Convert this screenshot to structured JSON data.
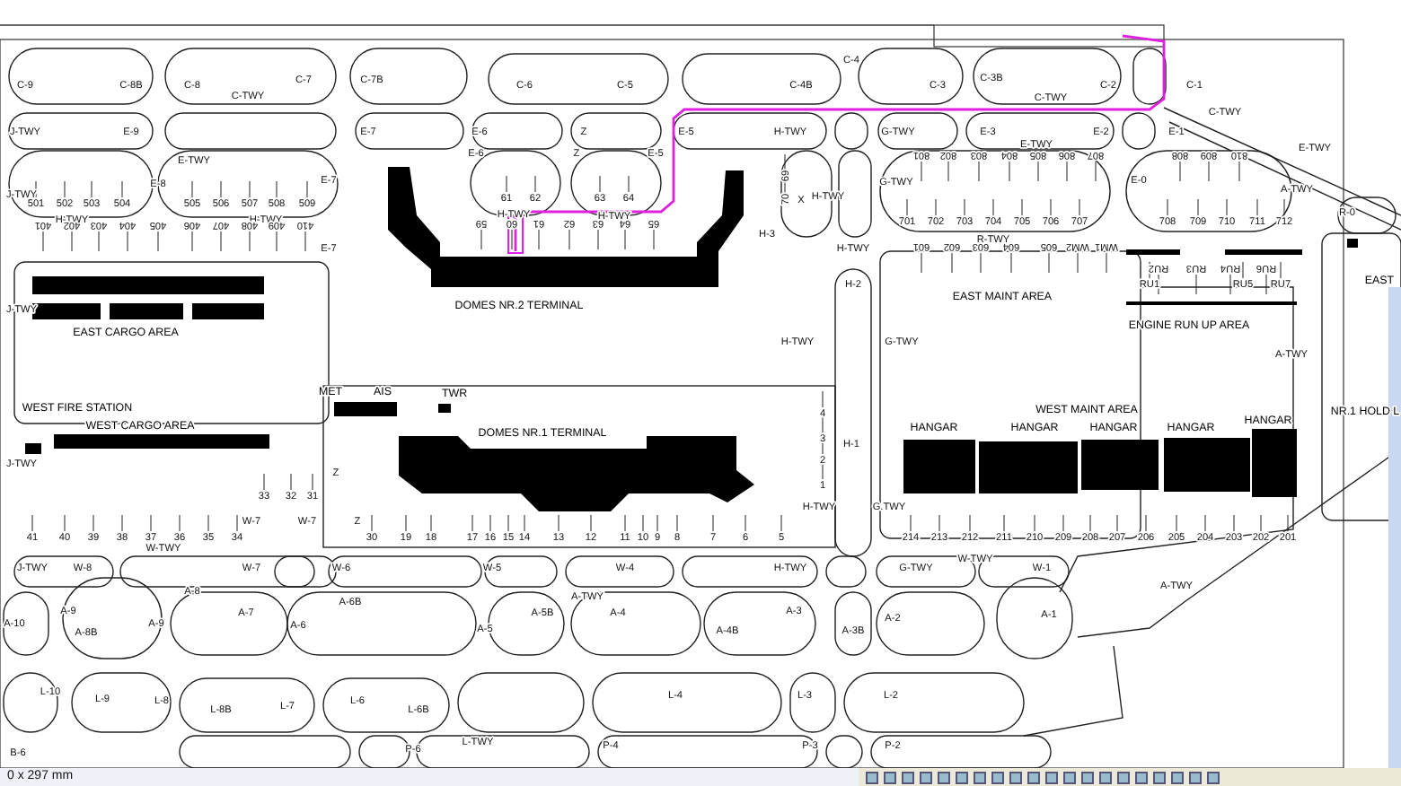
{
  "taxiway_labels": [
    "C-9",
    "C-8B",
    "C-8",
    "C-TWY",
    "C-7",
    "C-7B",
    "C-6",
    "C-5",
    "C-4B",
    "C-4",
    "C-3",
    "C-3B",
    "C-TWY",
    "C-2",
    "C-1",
    "C-TWY",
    "J-TWY",
    "E-9",
    "E-TWY",
    "E-7",
    "E-6",
    "Z",
    "E-5",
    "H-TWY",
    "G-TWY",
    "E-3",
    "E-TWY",
    "E-2",
    "E-1",
    "E-TWY",
    "J-TWY",
    "E-8",
    "E-6",
    "Z",
    "E-5",
    "X",
    "H-TWY",
    "G-TWY",
    "E-0",
    "A-TWY",
    "R-0",
    "H-TWY",
    "H-TWY",
    "H-TWY",
    "H-TWY",
    "R-TWY",
    "E-7",
    "E-7",
    "H-3",
    "H-TWY",
    "H-2",
    "J-TWY",
    "H-TWY",
    "G-TWY",
    "A-TWY",
    "J-TWY",
    "Z",
    "W-7",
    "W-7",
    "Z",
    "W-TWY",
    "H-1",
    "H-TWY",
    "G.TWY",
    "J-TWY",
    "W-8",
    "W-7",
    "W-6",
    "W-5",
    "W-4",
    "H-TWY",
    "G-TWY",
    "W-TWY",
    "W-1",
    "A-TWY",
    "A-TWY",
    "A-8",
    "A-6B",
    "A-9",
    "A-7",
    "A-5B",
    "A-4",
    "A-3",
    "A-1",
    "A-10",
    "A-9",
    "A-6",
    "A-5",
    "A-4B",
    "A-3B",
    "A-2",
    "A-8B",
    "L-10",
    "L-9",
    "L-8",
    "L-8B",
    "L-7",
    "L-6",
    "L-6B",
    "L-4",
    "L-3",
    "L-2",
    "L-TWY",
    "P-4",
    "P-3",
    "P-2",
    "B-6",
    "P-6"
  ],
  "stands": [
    "501",
    "502",
    "503",
    "504",
    "505",
    "506",
    "507",
    "508",
    "509",
    "401",
    "402",
    "403",
    "404",
    "405",
    "406",
    "407",
    "408",
    "409",
    "410",
    "61",
    "62",
    "63",
    "64",
    "59",
    "60",
    "61",
    "62",
    "63",
    "64",
    "65",
    "801",
    "802",
    "803",
    "804",
    "805",
    "806",
    "807",
    "808",
    "809",
    "810",
    "701",
    "702",
    "703",
    "704",
    "705",
    "706",
    "707",
    "708",
    "709",
    "710",
    "711",
    "712",
    "601",
    "602",
    "603",
    "604",
    "605",
    "WM2",
    "WM1",
    "RU1",
    "RU2",
    "RU3",
    "RU4",
    "RU5",
    "RU6",
    "RU7",
    "33",
    "32",
    "31",
    "41",
    "40",
    "39",
    "38",
    "37",
    "36",
    "35",
    "34",
    "30",
    "19",
    "18",
    "17",
    "16",
    "15",
    "14",
    "13",
    "12",
    "11",
    "10",
    "9",
    "8",
    "7",
    "6",
    "5",
    "214",
    "213",
    "212",
    "211",
    "210",
    "209",
    "208",
    "207",
    "206",
    "205",
    "204",
    "203",
    "202",
    "201",
    "69",
    "70",
    "4",
    "3",
    "2",
    "1"
  ],
  "areas": [
    "EAST CARGO AREA",
    "DOMES NR.2 TERMINAL",
    "EAST MAINT AREA",
    "ENGINE RUN UP AREA",
    "EAST",
    "MET",
    "AIS",
    "TWR",
    "WEST FIRE STATION",
    "WEST CARGO AREA",
    "DOMES NR.1 TERMINAL",
    "WEST MAINT AREA",
    "HANGAR",
    "HANGAR",
    "HANGAR",
    "HANGAR",
    "HANGAR",
    "NR.1 HOLD L"
  ],
  "status_bar": {
    "paper_size": "0 x 297 mm"
  }
}
